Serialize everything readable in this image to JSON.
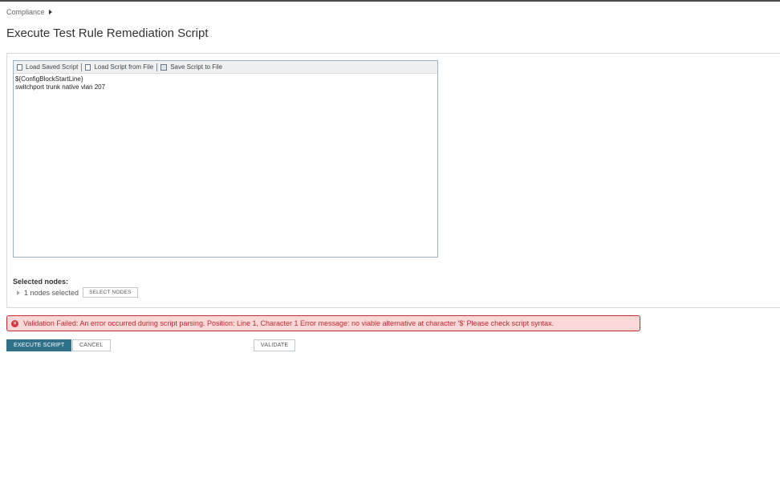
{
  "breadcrumb": {
    "item": "Compliance"
  },
  "page_title": "Execute Test Rule Remediation Script",
  "editor": {
    "toolbar": {
      "load_saved": "Load Saved Script",
      "load_file": "Load Script from File",
      "save_file": "Save Script to File"
    },
    "lines": [
      "${ConfigBlockStartLine}",
      "switchport trunk native vlan 207"
    ]
  },
  "nodes": {
    "label": "Selected nodes:",
    "count_text": "1 nodes selected",
    "select_button": "SELECT NODES"
  },
  "error": {
    "icon": "error-circle-icon",
    "message": "Validation Failed: An error occurred during script parsing. Position: Line 1, Character 1 Error message: no viable alternative at character '$' Please check script syntax.",
    "color": "#c0282d"
  },
  "actions": {
    "execute": "EXECUTE SCRIPT",
    "cancel": "CANCEL",
    "validate": "VALIDATE"
  },
  "colors": {
    "primary": "#2f7189",
    "error_bg": "#fbd9d9",
    "error_border": "#cc2b2b"
  }
}
